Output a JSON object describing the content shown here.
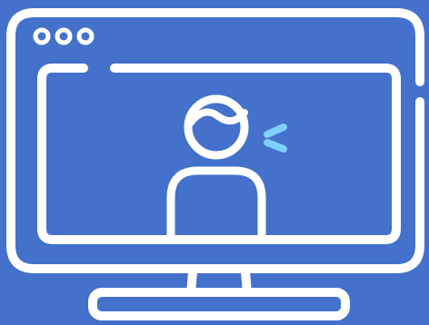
{
  "colors": {
    "background": "#4371cb",
    "stroke": "#ffffff",
    "accent": "#7fd0ff"
  },
  "icons": {
    "monitor": "monitor-icon",
    "window_controls": "window-dots-icon",
    "person": "person-icon",
    "sound_waves": "sound-waves-icon"
  }
}
